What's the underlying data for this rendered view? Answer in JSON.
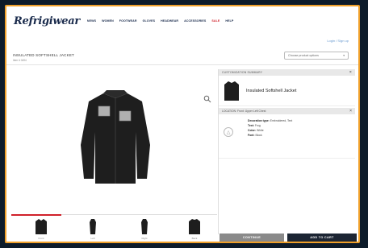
{
  "brand": {
    "logo": "Refrigiwear"
  },
  "nav": {
    "items": [
      "NEWS",
      "WOMEN",
      "FOOTWEAR",
      "GLOVES",
      "HEADWEAR",
      "ACCESSORIES",
      "SALE",
      "HELP"
    ]
  },
  "header": {
    "login_link": "Login / Sign up"
  },
  "product": {
    "title": "INSULATED SOFTSHELL JACKET",
    "subtitle": "Item # 0494",
    "select_placeholder": "Choose product options"
  },
  "thumbnails": [
    {
      "label": "Front"
    },
    {
      "label": "Left"
    },
    {
      "label": "Right"
    },
    {
      "label": "Back"
    }
  ],
  "panel": {
    "header": "CUSTOMIZATION SUMMARY",
    "product_name": "Insulated Softshell Jacket",
    "location_header": "LOCATION: Front: Upper Left Chest",
    "detail": {
      "decoration_label": "Decoration type:",
      "decoration_value": "Embroidered, Text",
      "text_label": "Text:",
      "text_value": "Frog",
      "color_label": "Color:",
      "color_value": "White",
      "font_label": "Font:",
      "font_value": "Block"
    }
  },
  "buttons": {
    "continue": "CONTINUE",
    "add_to_cart": "ADD TO CART"
  },
  "colors": {
    "accent_sale": "#d0202a",
    "navy": "#1a2b4c",
    "frame_border": "#f0a02a"
  }
}
